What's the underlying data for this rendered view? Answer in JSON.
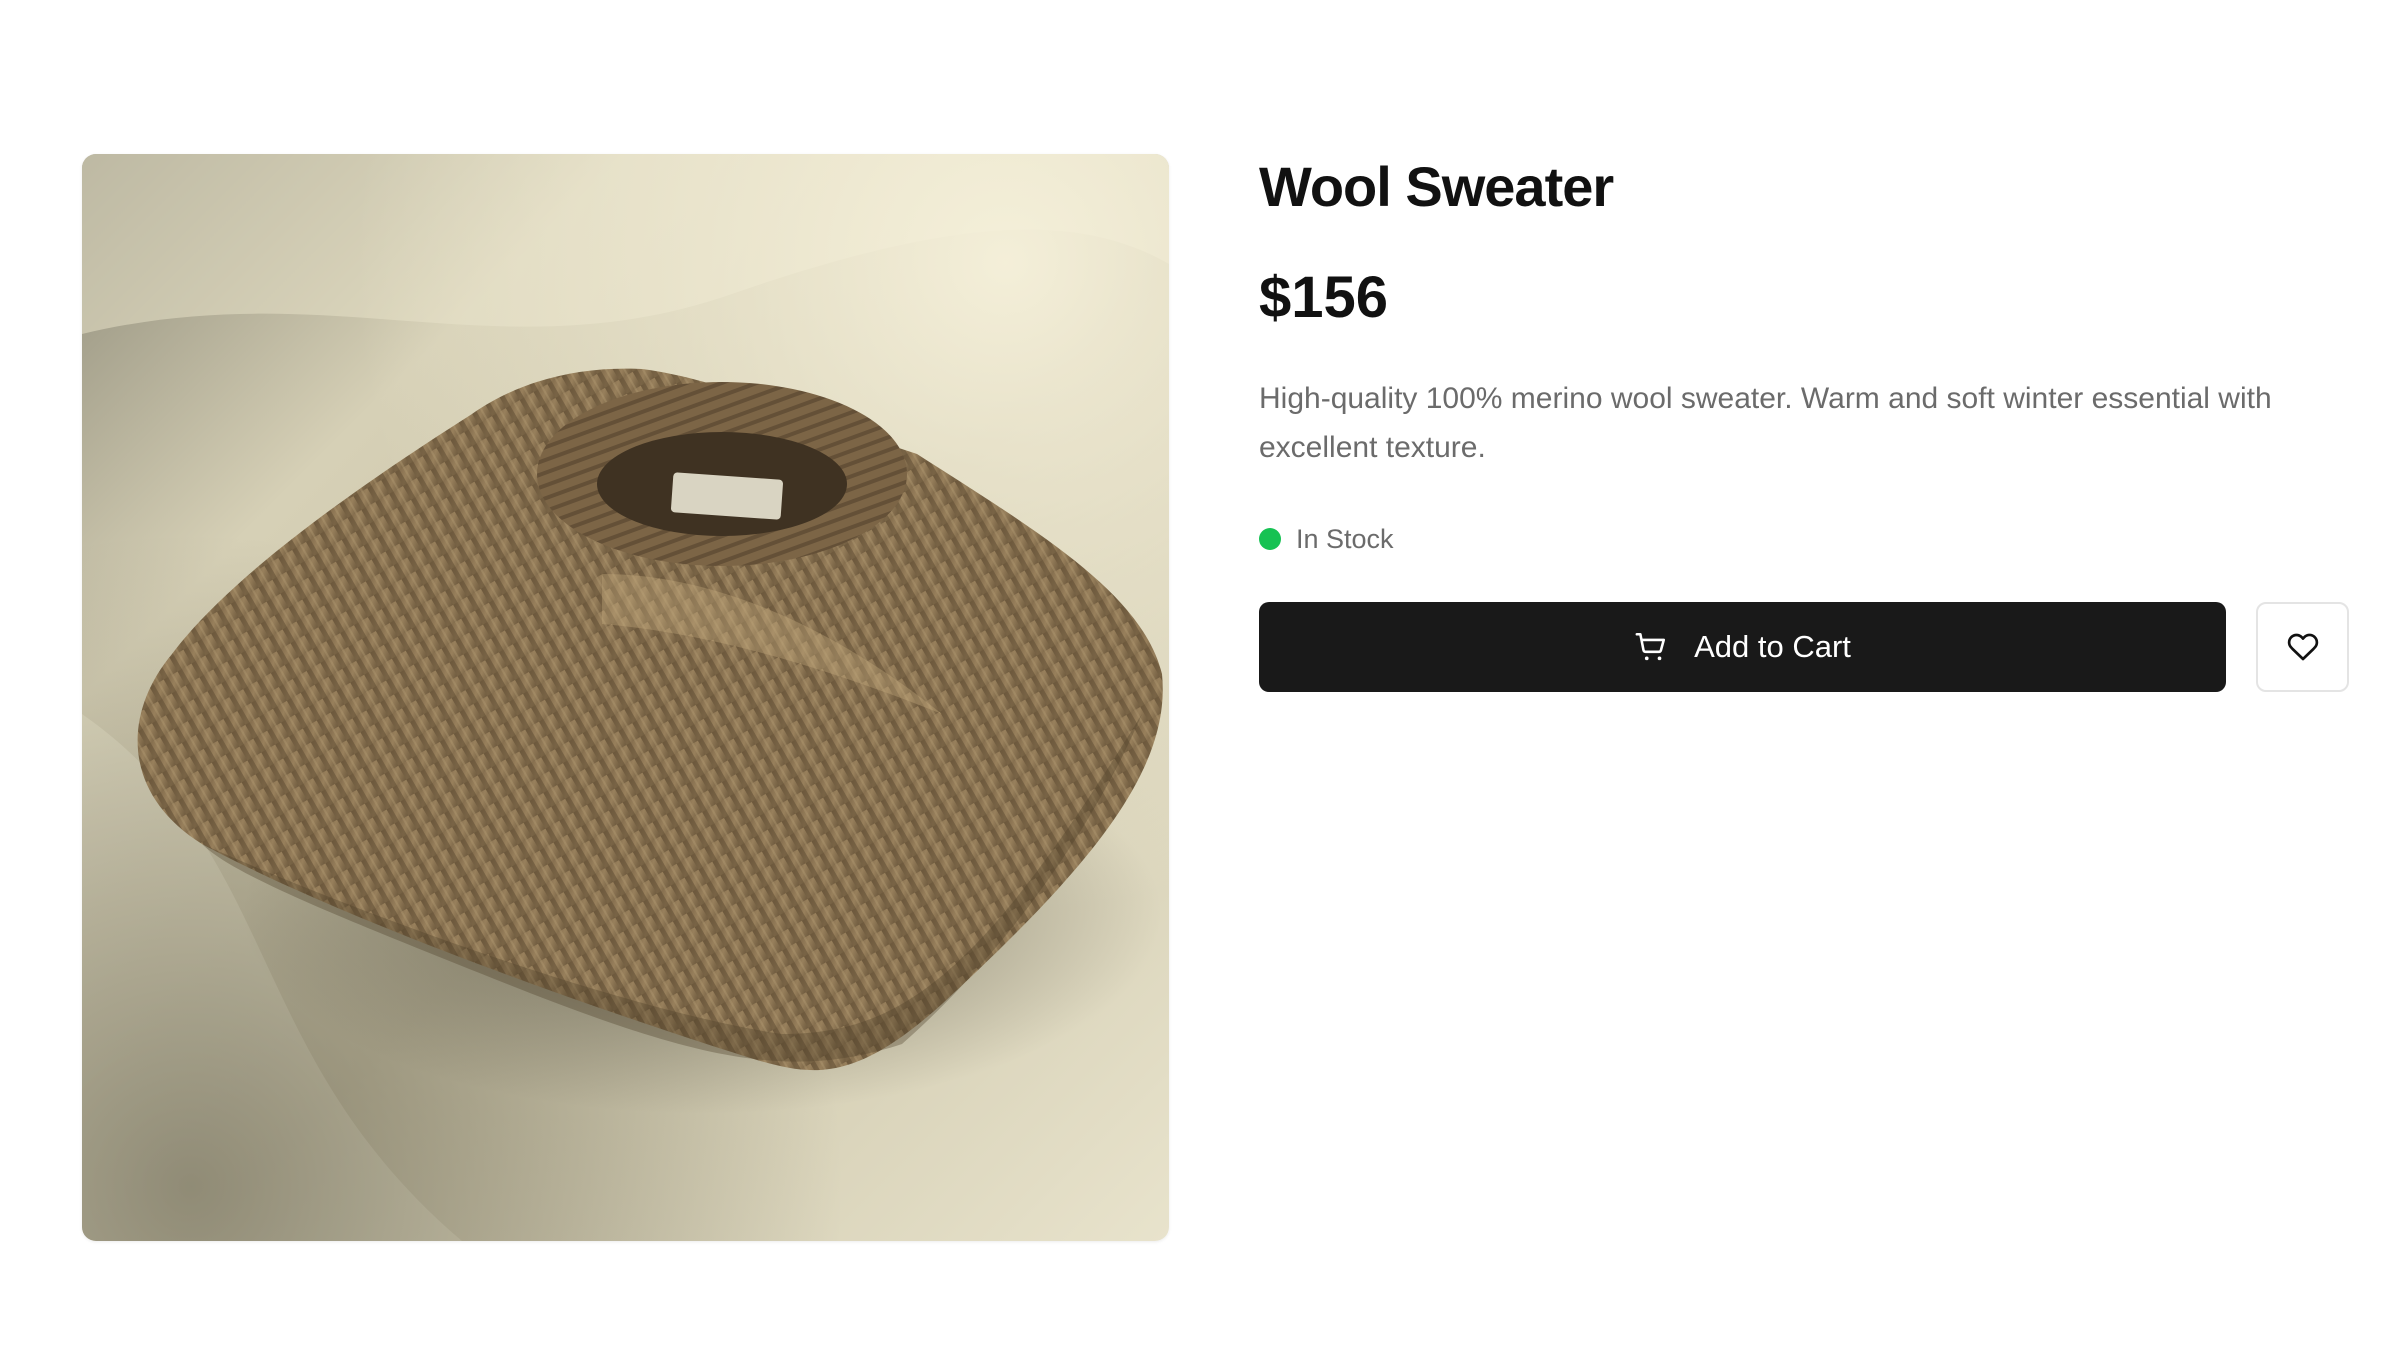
{
  "product": {
    "title": "Wool Sweater",
    "price": "$156",
    "description": "High-quality 100% merino wool sweater. Warm and soft winter essential with excellent texture.",
    "stock_status": "In Stock",
    "stock_color": "#16c253",
    "image_subject": "folded-brown-wool-sweater"
  },
  "actions": {
    "add_to_cart_label": "Add to Cart",
    "add_to_cart_icon": "cart-icon",
    "wishlist_icon": "heart-icon"
  },
  "colors": {
    "button_bg": "#191919",
    "text_primary": "#111111",
    "text_secondary": "#6b6b6b"
  }
}
